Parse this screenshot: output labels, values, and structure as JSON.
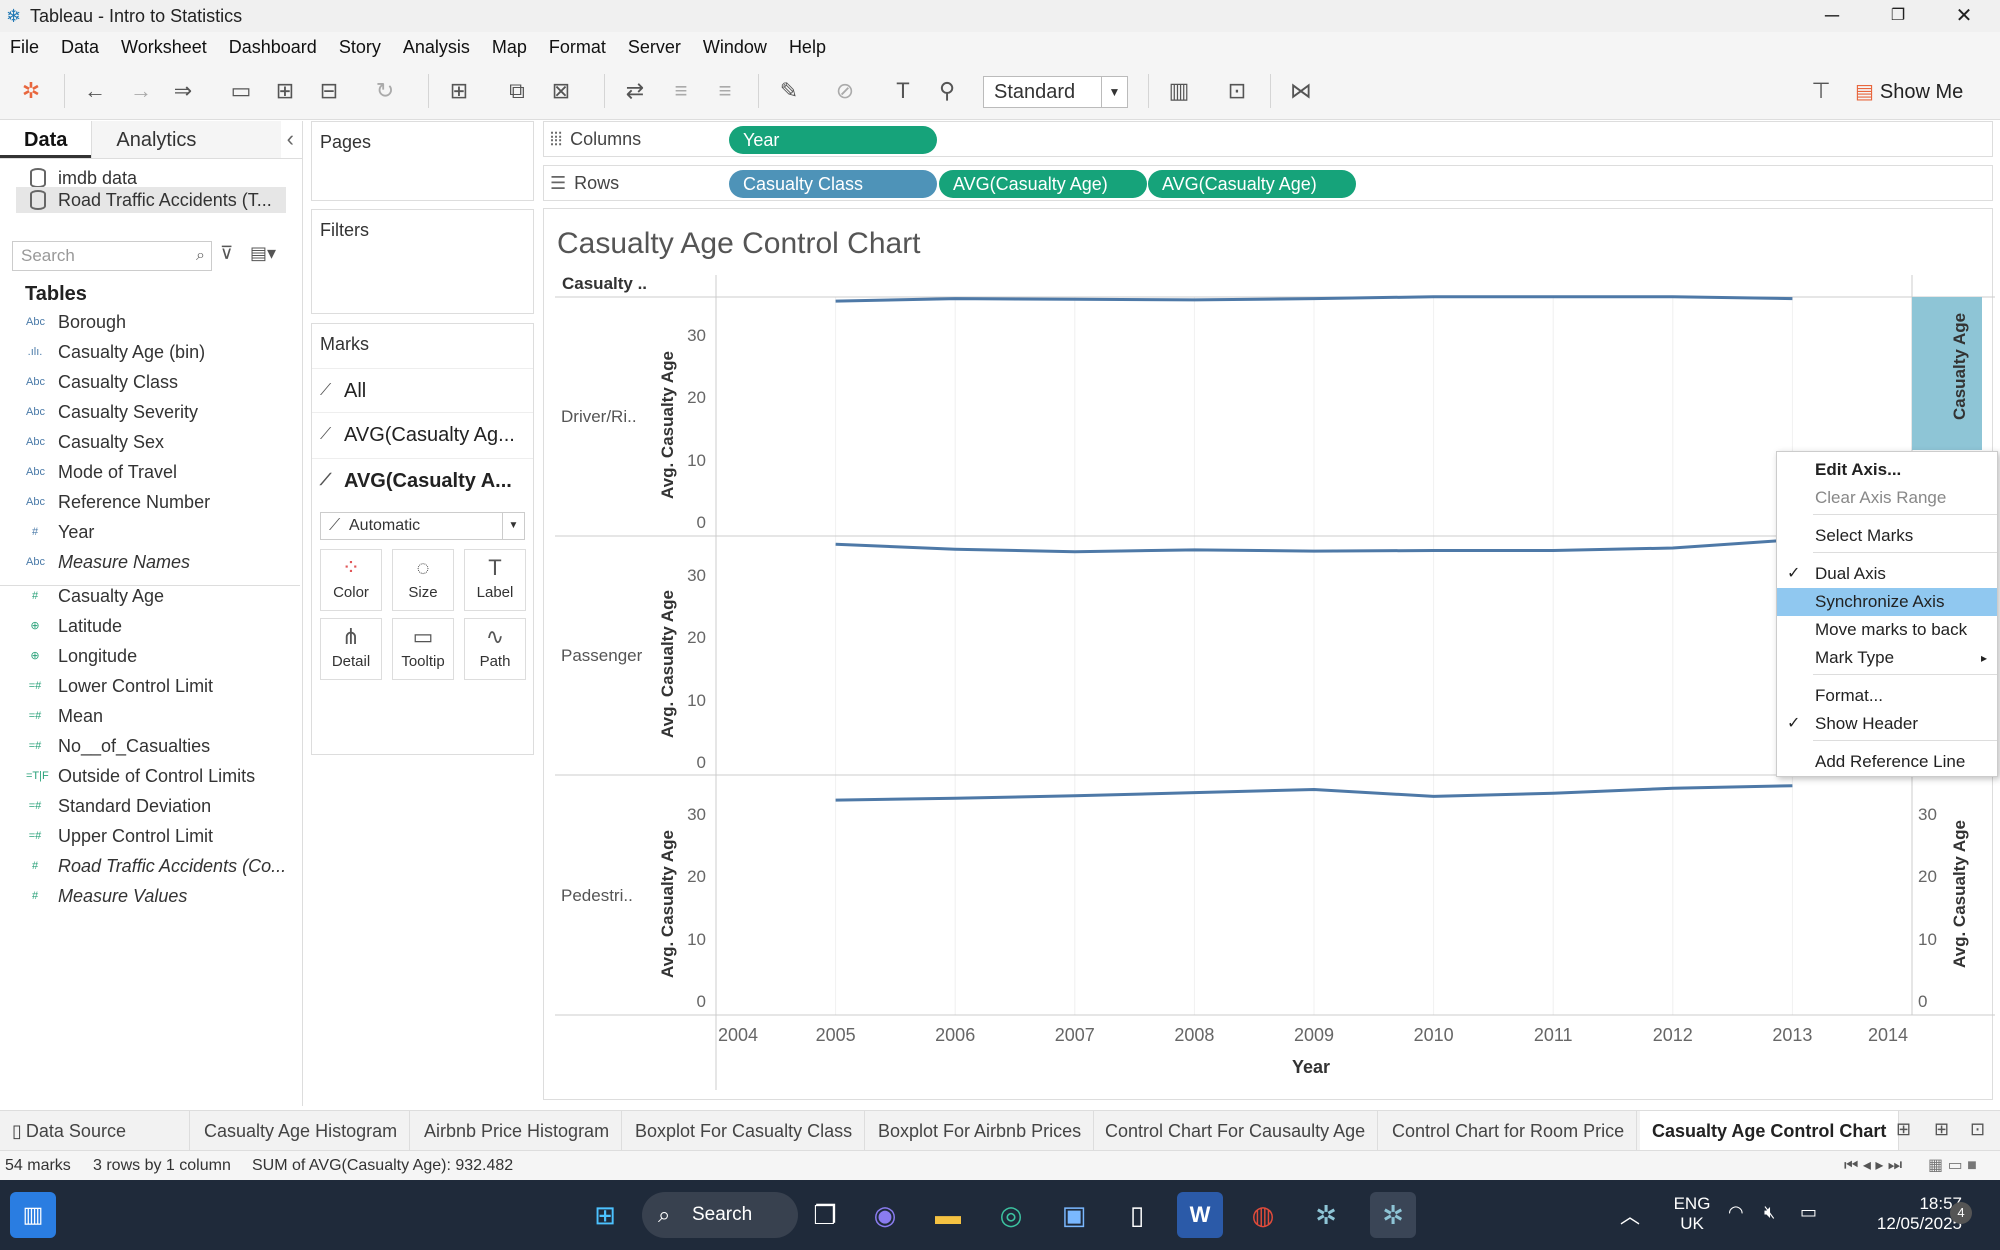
{
  "window": {
    "title": "Tableau - Intro to Statistics",
    "min": "─",
    "max": "❐",
    "close": "✕"
  },
  "menu": [
    "File",
    "Data",
    "Worksheet",
    "Dashboard",
    "Story",
    "Analysis",
    "Map",
    "Format",
    "Server",
    "Window",
    "Help"
  ],
  "toolbar": {
    "standard": "Standard",
    "show_me": "Show Me"
  },
  "datapane": {
    "tab_data": "Data",
    "tab_analytics": "Analytics",
    "collapse": "‹",
    "sources": [
      "imdb data",
      "Road Traffic Accidents (T..."
    ],
    "search_placeholder": "Search",
    "tables_heading": "Tables",
    "fields": [
      {
        "icon": "Abc",
        "label": "Borough",
        "kind": "dim"
      },
      {
        "icon": ".ılı.",
        "label": "Casualty Age (bin)",
        "kind": "dim"
      },
      {
        "icon": "Abc",
        "label": "Casualty Class",
        "kind": "dim"
      },
      {
        "icon": "Abc",
        "label": "Casualty Severity",
        "kind": "dim"
      },
      {
        "icon": "Abc",
        "label": "Casualty Sex",
        "kind": "dim"
      },
      {
        "icon": "Abc",
        "label": "Mode of Travel",
        "kind": "dim"
      },
      {
        "icon": "Abc",
        "label": "Reference Number",
        "kind": "dim"
      },
      {
        "icon": "#",
        "label": "Year",
        "kind": "dim"
      },
      {
        "icon": "Abc",
        "label": "Measure Names",
        "kind": "dim",
        "italic": true
      },
      {
        "icon": "#",
        "label": "Casualty Age",
        "kind": "mea"
      },
      {
        "icon": "⊕",
        "label": "Latitude",
        "kind": "mea"
      },
      {
        "icon": "⊕",
        "label": "Longitude",
        "kind": "mea"
      },
      {
        "icon": "=#",
        "label": "Lower Control Limit",
        "kind": "mea"
      },
      {
        "icon": "=#",
        "label": "Mean",
        "kind": "mea"
      },
      {
        "icon": "=#",
        "label": "No__of_Casualties",
        "kind": "mea"
      },
      {
        "icon": "=T|F",
        "label": "Outside of Control Limits",
        "kind": "mea"
      },
      {
        "icon": "=#",
        "label": "Standard Deviation",
        "kind": "mea"
      },
      {
        "icon": "=#",
        "label": "Upper Control Limit",
        "kind": "mea"
      },
      {
        "icon": "#",
        "label": "Road Traffic Accidents (Co...",
        "kind": "mea",
        "italic": true
      },
      {
        "icon": "#",
        "label": "Measure Values",
        "kind": "mea",
        "italic": true
      }
    ]
  },
  "cards": {
    "pages": "Pages",
    "filters": "Filters",
    "marks": "Marks",
    "mark_rows": [
      "All",
      "AVG(Casualty Ag...",
      "AVG(Casualty A..."
    ],
    "mark_type": "Automatic",
    "buttons": [
      {
        "icon": "⁘",
        "label": "Color"
      },
      {
        "icon": "◌",
        "label": "Size"
      },
      {
        "icon": "T",
        "label": "Label"
      },
      {
        "icon": "⋔",
        "label": "Detail"
      },
      {
        "icon": "▭",
        "label": "Tooltip"
      },
      {
        "icon": "∿",
        "label": "Path"
      }
    ]
  },
  "shelves": {
    "columns_label": "Columns",
    "rows_label": "Rows",
    "columns_pills": [
      "Year"
    ],
    "rows_pills": [
      "Casualty Class",
      "AVG(Casualty Age)",
      "AVG(Casualty Age)"
    ]
  },
  "viz": {
    "title": "Casualty Age Control Chart",
    "column_header": "Casualty ..",
    "x_title": "Year",
    "y_title": "Avg. Casualty Age",
    "right_y_title": "Casualty Age",
    "right_y_title_full": "Avg. Casualty Age"
  },
  "chart_data": {
    "type": "line",
    "x": [
      2005,
      2006,
      2007,
      2008,
      2009,
      2010,
      2011,
      2012,
      2013
    ],
    "xlim": [
      2004,
      2014
    ],
    "x_ticks": [
      "2004",
      "2005",
      "2006",
      "2007",
      "2008",
      "2009",
      "2010",
      "2011",
      "2012",
      "2013",
      "2014"
    ],
    "y_ticks": [
      "0",
      "10",
      "20",
      "30"
    ],
    "ylim": [
      0,
      38
    ],
    "xlabel": "Year",
    "ylabel": "Avg. Casualty Age",
    "panels": [
      {
        "label": "Driver/Ri..",
        "values": [
          35.5,
          35.9,
          35.8,
          35.7,
          35.9,
          36.2,
          36.2,
          36.2,
          35.9
        ]
      },
      {
        "label": "Passenger",
        "values": [
          35.0,
          34.2,
          33.8,
          34.1,
          33.9,
          34.0,
          34.0,
          34.4,
          35.7
        ]
      },
      {
        "label": "Pedestri..",
        "values": [
          32.3,
          32.6,
          33.0,
          33.5,
          34.0,
          32.9,
          33.4,
          34.2,
          34.6
        ]
      }
    ],
    "line_color": "#4e79a7"
  },
  "context_menu": [
    {
      "label": "Edit Axis...",
      "bold": true
    },
    {
      "label": "Clear Axis Range",
      "disabled": true
    },
    {
      "label": "Select Marks"
    },
    {
      "label": "Dual Axis",
      "checked": true
    },
    {
      "label": "Synchronize Axis",
      "highlighted": true
    },
    {
      "label": "Move marks to back"
    },
    {
      "label": "Mark Type",
      "submenu": true
    },
    {
      "label": "Format..."
    },
    {
      "label": "Show Header",
      "checked": true
    },
    {
      "label": "Add Reference Line"
    }
  ],
  "sheet_tabs": [
    "Data Source",
    "Casualty Age Histogram",
    "Airbnb Price Histogram",
    "Boxplot For Casualty Class",
    "Boxplot For Airbnb Prices",
    "Control Chart For Causaulty Age",
    "Control Chart for Room Price",
    "Casualty Age Control Chart"
  ],
  "status": {
    "marks": "54 marks",
    "dims": "3 rows by 1 column",
    "sum": "SUM of AVG(Casualty Age): 932.482"
  },
  "taskbar": {
    "search": "Search",
    "lang1": "ENG",
    "lang2": "UK",
    "time": "18:57",
    "date": "12/05/2025",
    "notif": "4"
  }
}
